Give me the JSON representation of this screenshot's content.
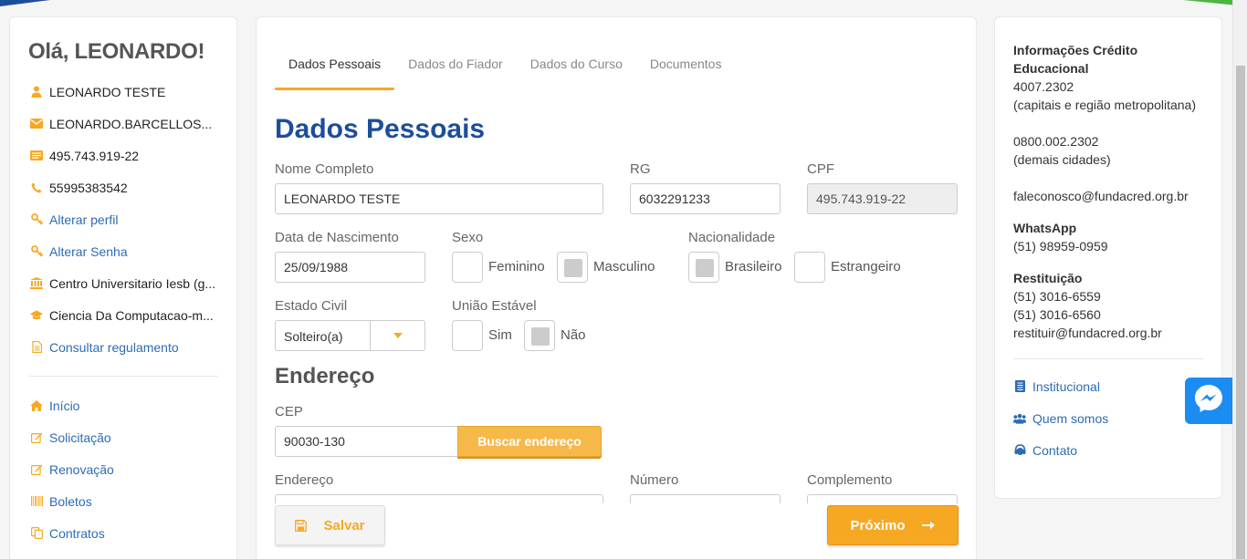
{
  "colors": {
    "accent": "#f7a823",
    "brand_blue": "#1c4e9a",
    "link": "#2d6cb4",
    "messenger": "#1b8cf2"
  },
  "sidebar": {
    "greeting": "Olá, LEONARDO!",
    "user_info": [
      {
        "icon": "user-icon",
        "text": "LEONARDO TESTE"
      },
      {
        "icon": "envelope-icon",
        "text": "LEONARDO.BARCELLOS..."
      },
      {
        "icon": "id-card-icon",
        "text": "495.743.919-22"
      },
      {
        "icon": "phone-icon",
        "text": "55995383542"
      }
    ],
    "actions": [
      {
        "icon": "key-icon",
        "text": "Alterar perfil"
      },
      {
        "icon": "key-icon",
        "text": "Alterar Senha"
      }
    ],
    "academic": [
      {
        "icon": "university-icon",
        "text": "Centro Universitario Iesb (g..."
      },
      {
        "icon": "graduation-cap-icon",
        "text": "Ciencia Da Computacao-m..."
      }
    ],
    "regulation": {
      "icon": "document-icon",
      "text": "Consultar regulamento"
    },
    "nav": [
      {
        "icon": "home-icon",
        "text": "Início"
      },
      {
        "icon": "edit-icon",
        "text": "Solicitação"
      },
      {
        "icon": "edit-icon",
        "text": "Renovação"
      },
      {
        "icon": "barcode-icon",
        "text": "Boletos"
      },
      {
        "icon": "copy-icon",
        "text": "Contratos"
      }
    ]
  },
  "main": {
    "tabs": [
      "Dados Pessoais",
      "Dados do Fiador",
      "Dados do Curso",
      "Documentos"
    ],
    "active_tab": "Dados Pessoais",
    "title": "Dados Pessoais",
    "fields": {
      "nome": {
        "label": "Nome Completo",
        "value": "LEONARDO TESTE"
      },
      "rg": {
        "label": "RG",
        "value": "6032291233"
      },
      "cpf": {
        "label": "CPF",
        "value": "495.743.919-22"
      },
      "nascimento": {
        "label": "Data de Nascimento",
        "value": "25/09/1988"
      },
      "sexo": {
        "label": "Sexo",
        "options": [
          "Feminino",
          "Masculino"
        ],
        "selected": "Masculino"
      },
      "nacionalidade": {
        "label": "Nacionalidade",
        "options": [
          "Brasileiro",
          "Estrangeiro"
        ],
        "selected": "Brasileiro"
      },
      "estado_civil": {
        "label": "Estado Civil",
        "value": "Solteiro(a)"
      },
      "uniao_estavel": {
        "label": "União Estável",
        "options": [
          "Sim",
          "Não"
        ],
        "selected": "Não"
      }
    },
    "endereco_title": "Endereço",
    "cep": {
      "label": "CEP",
      "value": "90030-130",
      "button": "Buscar endereço"
    },
    "endereco": {
      "label": "Endereço"
    },
    "numero": {
      "label": "Número"
    },
    "complemento": {
      "label": "Complemento"
    },
    "save_label": "Salvar",
    "next_label": "Próximo"
  },
  "info": {
    "credit_title": "Informações Crédito Educacional",
    "phone1": "4007.2302",
    "phone1_note": "(capitais e região metropolitana)",
    "phone2": "0800.002.2302",
    "phone2_note": "(demais cidades)",
    "email": "faleconosco@fundacred.org.br",
    "whatsapp_title": "WhatsApp",
    "whatsapp": "(51) 98959-0959",
    "restituicao_title": "Restituição",
    "rest_phone1": "(51) 3016-6559",
    "rest_phone2": "(51) 3016-6560",
    "rest_email": "restituir@fundacred.org.br",
    "links": [
      {
        "icon": "building-icon",
        "text": "Institucional"
      },
      {
        "icon": "users-icon",
        "text": "Quem somos"
      },
      {
        "icon": "headset-icon",
        "text": "Contato"
      }
    ]
  }
}
